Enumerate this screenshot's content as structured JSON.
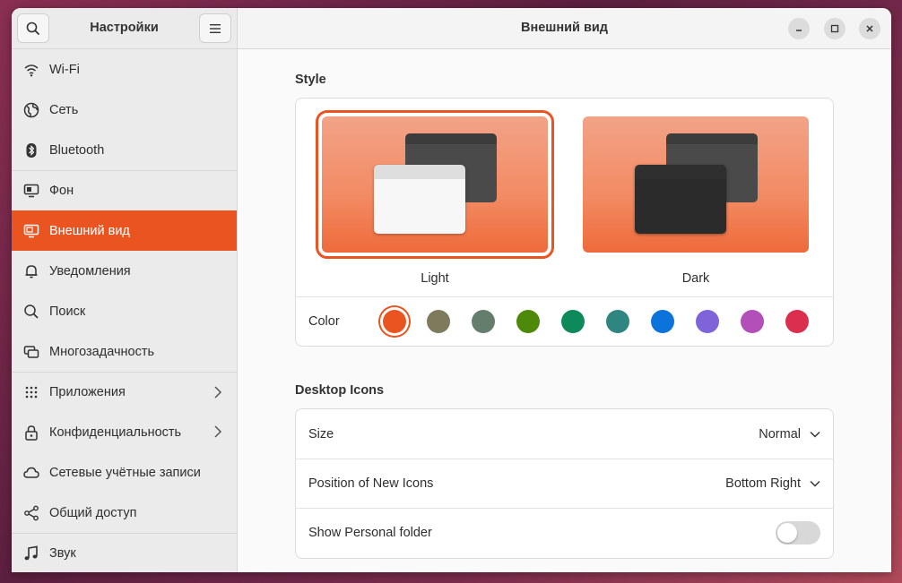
{
  "sidebar": {
    "title": "Настройки",
    "items": [
      {
        "label": "Wi-Fi",
        "icon": "wifi-icon"
      },
      {
        "label": "Сеть",
        "icon": "globe-icon"
      },
      {
        "label": "Bluetooth",
        "icon": "bluetooth-icon"
      },
      {
        "label": "Фон",
        "icon": "monitor-icon"
      },
      {
        "label": "Внешний вид",
        "icon": "appearance-icon"
      },
      {
        "label": "Уведомления",
        "icon": "bell-icon"
      },
      {
        "label": "Поиск",
        "icon": "search-icon"
      },
      {
        "label": "Многозадачность",
        "icon": "multitasking-icon"
      },
      {
        "label": "Приложения",
        "icon": "apps-grid-icon"
      },
      {
        "label": "Конфиденциальность",
        "icon": "lock-icon"
      },
      {
        "label": "Сетевые учётные записи",
        "icon": "cloud-icon"
      },
      {
        "label": "Общий доступ",
        "icon": "share-icon"
      },
      {
        "label": "Звук",
        "icon": "music-note-icon"
      }
    ]
  },
  "header": {
    "title": "Внешний вид"
  },
  "style": {
    "title": "Style",
    "themes": [
      {
        "label": "Light",
        "selected": true
      },
      {
        "label": "Dark",
        "selected": false
      }
    ],
    "color_label": "Color",
    "colors": [
      "#e95420",
      "#7e7a5c",
      "#647d6d",
      "#4e8a0a",
      "#0e8a5a",
      "#2f8580",
      "#0b73da",
      "#7e64d8",
      "#b24fb8",
      "#dc2f4e"
    ],
    "accent": "#e95420"
  },
  "desktop_icons": {
    "title": "Desktop Icons",
    "size_label": "Size",
    "size_value": "Normal",
    "position_label": "Position of New Icons",
    "position_value": "Bottom Right",
    "personal_label": "Show Personal folder",
    "personal_on": false
  }
}
